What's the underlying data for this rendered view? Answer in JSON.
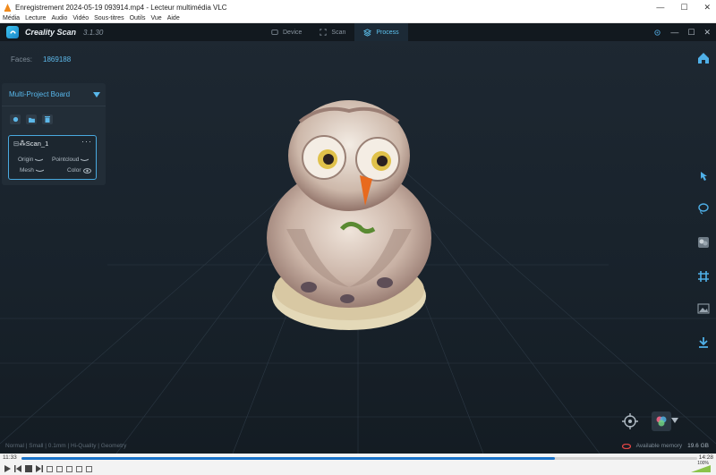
{
  "vlc": {
    "title": "Enregistrement 2024-05-19 093914.mp4 - Lecteur multimédia VLC",
    "menu": [
      "Média",
      "Lecture",
      "Audio",
      "Vidéo",
      "Sous-titres",
      "Outils",
      "Vue",
      "Aide"
    ],
    "time_current": "11:33",
    "time_total": "14:28",
    "progress": 0.79,
    "volume": "100%"
  },
  "app": {
    "name": "Creality Scan",
    "version": "3.1.30",
    "tabs": [
      {
        "label": "Device",
        "active": false
      },
      {
        "label": "Scan",
        "active": false
      },
      {
        "label": "Process",
        "active": true
      }
    ]
  },
  "faces": {
    "label": "Faces:",
    "value": "1869188"
  },
  "panel": {
    "title": "Multi-Project Board",
    "scan": {
      "name": "Scan_1",
      "options": {
        "origin": "Origin",
        "pointcloud": "Pointcloud",
        "mesh": "Mesh",
        "color": "Color"
      }
    }
  },
  "status": {
    "settings": "Normal | Small | 0.1mm | Hi-Quality | Geometry",
    "memory_label": "Available memory",
    "memory_value": "19.6 GB"
  },
  "colors": {
    "accent": "#5cb8ea",
    "panel_bg": "#222d37",
    "bg": "#1b2229"
  },
  "icons": [
    "home-icon",
    "pointer-icon",
    "lasso-icon",
    "texture-icon",
    "grid-crop-icon",
    "image-icon",
    "download-icon",
    "target-icon",
    "palette-icon"
  ]
}
